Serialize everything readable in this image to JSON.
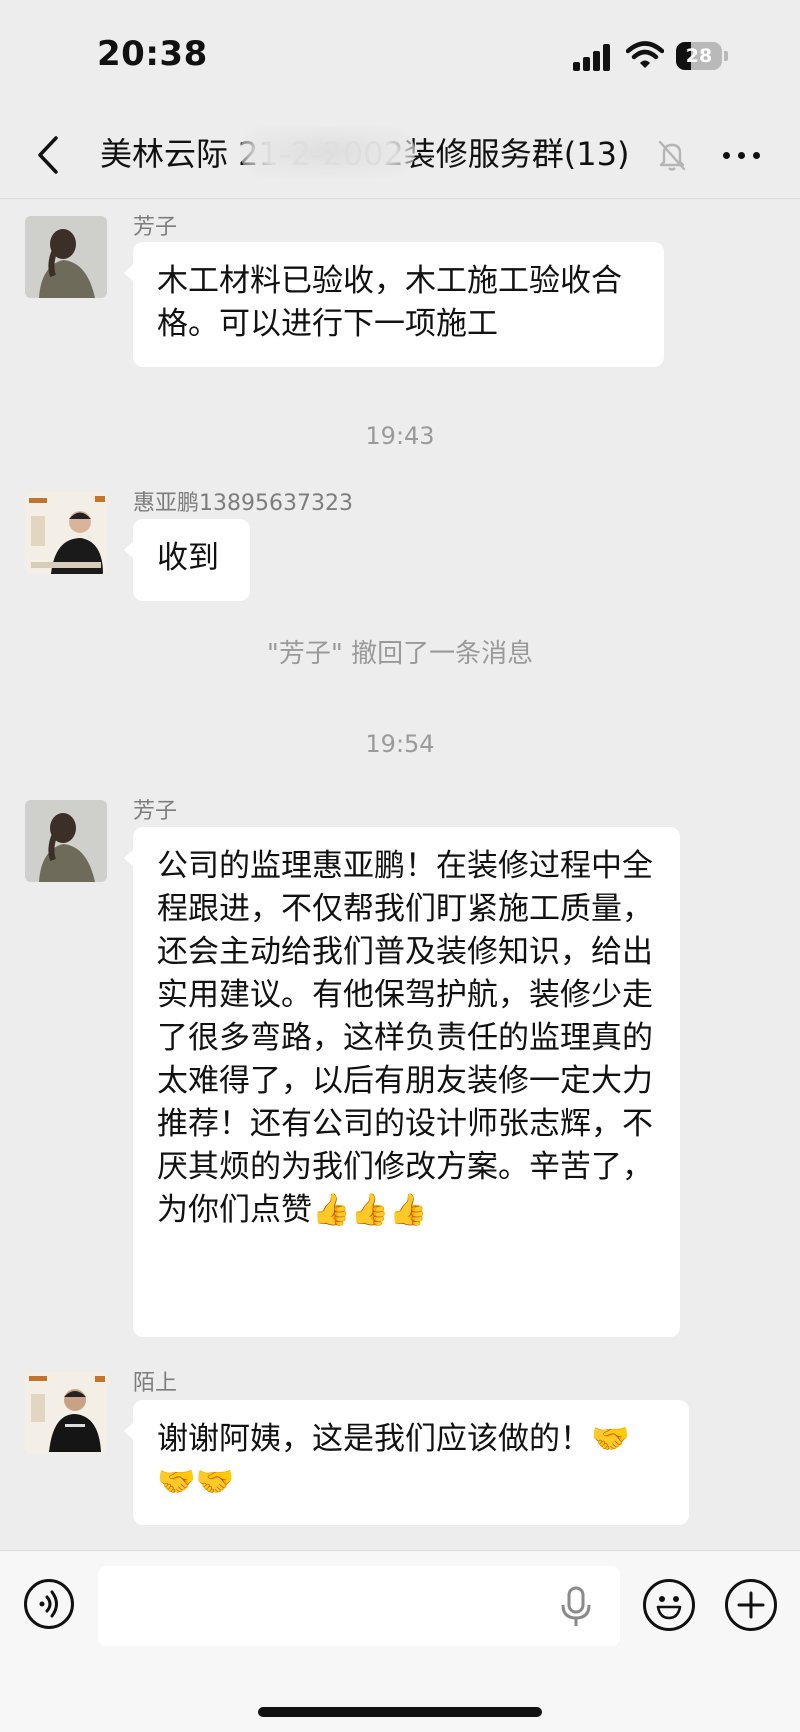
{
  "status_bar": {
    "time": "20:38",
    "battery": "28"
  },
  "header": {
    "title": "美林云际 21-2-2002装修服务群(13)"
  },
  "messages": [
    {
      "sender": "芳子",
      "text": "木工材料已验收，木工施工验收合格。可以进行下一项施工"
    },
    {
      "timestamp": "19:43"
    },
    {
      "sender": "惠亚鹏13895637323",
      "text": "收到"
    },
    {
      "system": "\"芳子\" 撤回了一条消息"
    },
    {
      "timestamp": "19:54"
    },
    {
      "sender": "芳子",
      "text": "公司的监理惠亚鹏！在装修过程中全程跟进，不仅帮我们盯紧施工质量，还会主动给我们普及装修知识，给出实用建议。有他保驾护航，装修少走了很多弯路，这样负责任的监理真的太难得了，以后有朋友装修一定大力推荐！还有公司的设计师张志辉，不厌其烦的为我们修改方案。辛苦了，为你们点赞",
      "emoji": "👍👍👍"
    },
    {
      "sender": "陌上",
      "text": "谢谢阿姨，这是我们应该做的！",
      "emoji": "🤝🤝🤝"
    }
  ],
  "input": {
    "value": ""
  },
  "colors": {
    "background": "#ededed",
    "bubble": "#ffffff",
    "meta_text": "#9a9a9a"
  }
}
